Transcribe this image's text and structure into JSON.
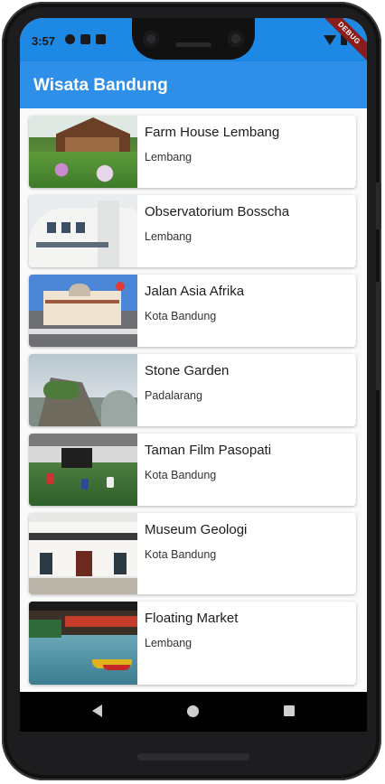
{
  "status_bar": {
    "time": "3:57",
    "left_icons": [
      "gear-icon",
      "shield-icon",
      "sd-card-icon"
    ],
    "right_icons": [
      "wifi-icon",
      "battery-icon"
    ],
    "debug_banner": "DEBUG"
  },
  "app_bar": {
    "title": "Wisata Bandung",
    "color": "#2e8fe8"
  },
  "places": [
    {
      "name": "Farm House Lembang",
      "location": "Lembang"
    },
    {
      "name": "Observatorium Bosscha",
      "location": "Lembang"
    },
    {
      "name": "Jalan Asia Afrika",
      "location": "Kota Bandung"
    },
    {
      "name": "Stone Garden",
      "location": "Padalarang"
    },
    {
      "name": "Taman Film Pasopati",
      "location": "Kota Bandung"
    },
    {
      "name": "Museum Geologi",
      "location": "Kota Bandung"
    },
    {
      "name": "Floating Market",
      "location": "Lembang"
    }
  ],
  "nav_bar": {
    "icons": [
      "back-icon",
      "home-icon",
      "recent-apps-icon"
    ]
  }
}
